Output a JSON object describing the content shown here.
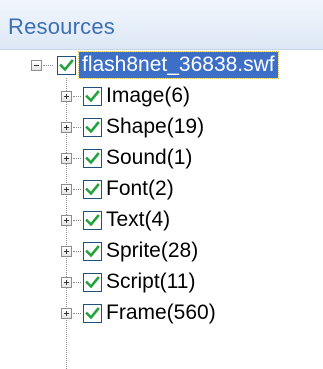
{
  "panel": {
    "title": "Resources"
  },
  "tree": {
    "root": {
      "label": "flash8net_36838.swf",
      "expanded": true,
      "checked": true,
      "selected": true
    },
    "children": [
      {
        "label": "Image(6)",
        "checked": true,
        "expanded": false
      },
      {
        "label": "Shape(19)",
        "checked": true,
        "expanded": false
      },
      {
        "label": "Sound(1)",
        "checked": true,
        "expanded": false
      },
      {
        "label": "Font(2)",
        "checked": true,
        "expanded": false
      },
      {
        "label": "Text(4)",
        "checked": true,
        "expanded": false
      },
      {
        "label": "Sprite(28)",
        "checked": true,
        "expanded": false
      },
      {
        "label": "Script(11)",
        "checked": true,
        "expanded": false
      },
      {
        "label": "Frame(560)",
        "checked": true,
        "expanded": false
      }
    ]
  },
  "colors": {
    "header_text": "#3c6fb4",
    "check_mark": "#22a33c",
    "selection": "#3d6fc7"
  },
  "icons": {
    "expander_expanded": "minus-box-icon",
    "expander_collapsed": "plus-box-icon",
    "checkbox": "checkmark-icon"
  }
}
